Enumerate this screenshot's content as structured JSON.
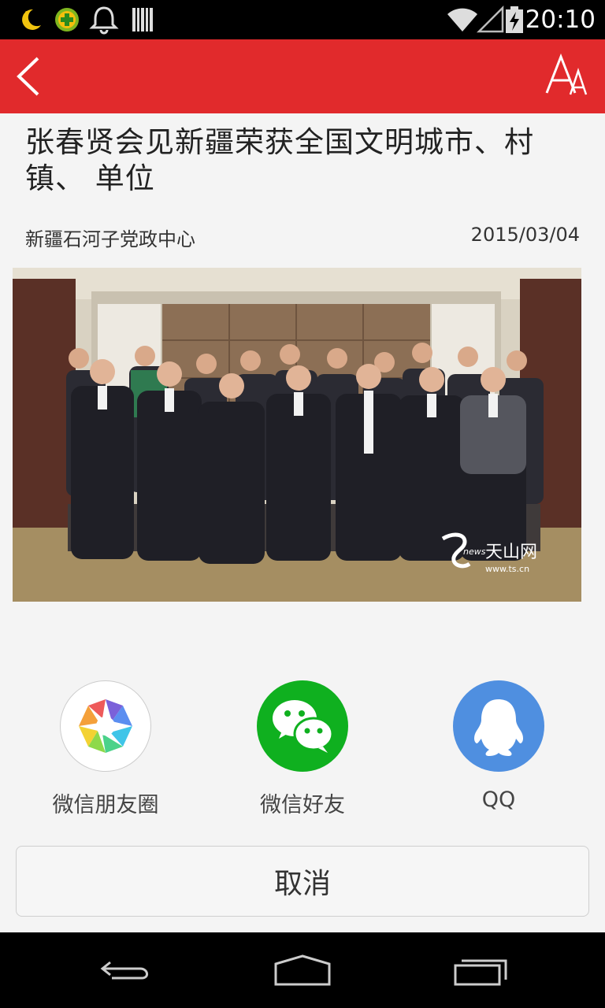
{
  "status_bar": {
    "time": "20:10",
    "icons": [
      "moon-icon",
      "app-plus-icon",
      "bell-icon",
      "barcode-icon",
      "wifi-icon",
      "signal-icon",
      "battery-charging-icon"
    ]
  },
  "top_bar": {
    "back_icon": "chevron-left-icon",
    "font_size_icon": "font-size-icon",
    "background": "#e12a2c"
  },
  "article": {
    "title": "张春贤会见新疆荣获全国文明城市、村镇、 单位",
    "source": "新疆石河子党政中心",
    "date": "2015/03/04",
    "photo": {
      "description_icon": "group-photo",
      "watermark_brand": "天山网",
      "watermark_sub": "news",
      "watermark_url": "www.ts.cn"
    }
  },
  "share_sheet": {
    "options": [
      {
        "label": "微信朋友圈",
        "icon": "moments-icon"
      },
      {
        "label": "微信好友",
        "icon": "wechat-icon"
      },
      {
        "label": "QQ",
        "icon": "qq-icon"
      }
    ],
    "cancel_label": "取消"
  },
  "nav_bar": {
    "icons": [
      "back-nav-icon",
      "home-nav-icon",
      "recents-nav-icon"
    ]
  }
}
